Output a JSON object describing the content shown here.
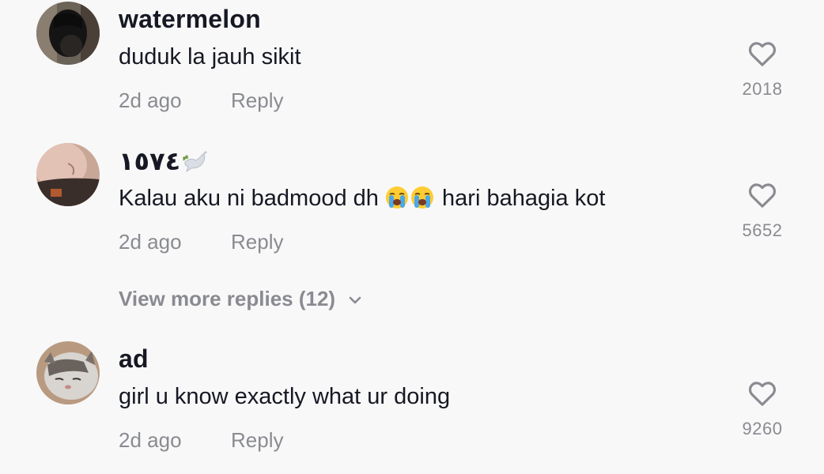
{
  "comments": [
    {
      "username": "watermelon",
      "text": "duduk la jauh sikit",
      "time": "2d ago",
      "reply": "Reply",
      "likes": "2018"
    },
    {
      "username": "١٥٧٤",
      "text_before": "Kalau aku ni badmood dh ",
      "text_after": " hari bahagia kot",
      "emoji": "loudly-crying-face",
      "time": "2d ago",
      "reply": "Reply",
      "likes": "5652"
    },
    {
      "username": "ad",
      "text": "girl u know exactly what ur doing",
      "time": "2d ago",
      "reply": "Reply",
      "likes": "9260"
    }
  ],
  "view_more_replies": "View more replies (12)",
  "colors": {
    "background": "#f8f8f8",
    "primary_text": "#161823",
    "secondary_text": "#8a8b91"
  }
}
